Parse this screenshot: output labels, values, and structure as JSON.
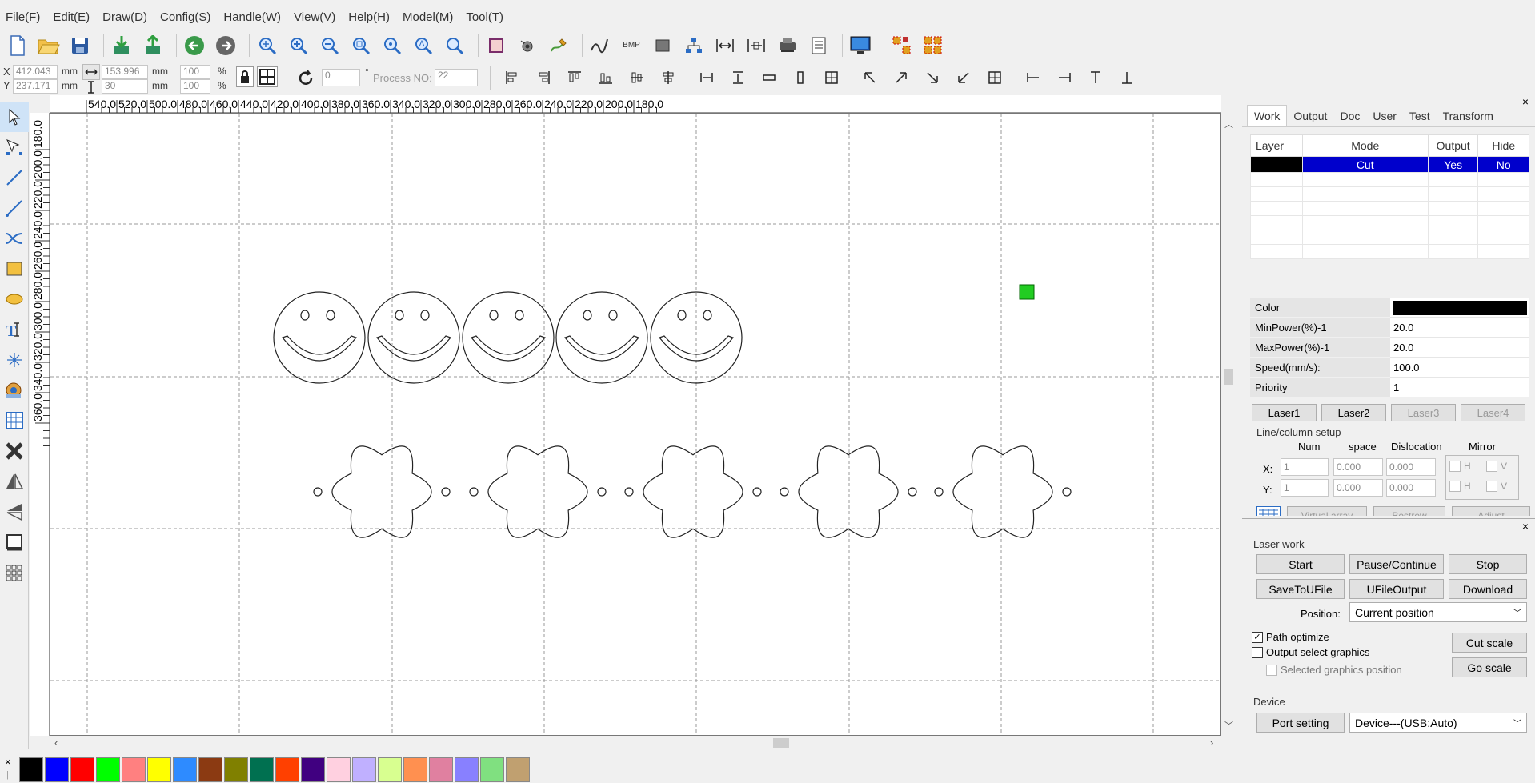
{
  "menu": [
    "File(F)",
    "Edit(E)",
    "Draw(D)",
    "Config(S)",
    "Handle(W)",
    "View(V)",
    "Help(H)",
    "Model(M)",
    "Tool(T)"
  ],
  "toolbar": {
    "file_icons": [
      "new-file-icon",
      "open-folder-icon",
      "save-icon"
    ],
    "import_icons": [
      "import-icon",
      "export-icon",
      "undo-icon",
      "redo-icon"
    ],
    "zoom_icons": [
      "zoom-select-icon",
      "zoom-in-icon",
      "zoom-out-icon",
      "zoom-page-icon",
      "zoom-fit-icon",
      "zoom-real-icon",
      "zoom-window-icon"
    ],
    "bmp_label": "BMP"
  },
  "position_bar": {
    "x_label": "X",
    "y_label": "Y",
    "x_value": "412.043",
    "y_value": "237.171",
    "w_value": "153.996",
    "h_value": "30",
    "unit_mm": "mm",
    "scale_x": "100",
    "scale_y": "100",
    "percent": "%",
    "rotate_value": "0",
    "degree": "°",
    "process_label": "Process NO:",
    "process_value": "22"
  },
  "rulers": {
    "h_ticks": [
      "540.0",
      "520.0",
      "500.0",
      "480.0",
      "460.0",
      "440.0",
      "420.0",
      "400.0",
      "380.0",
      "360.0",
      "340.0",
      "320.0",
      "300.0",
      "280.0",
      "260.0",
      "240.0",
      "220.0",
      "200.0",
      "180.0"
    ],
    "v_ticks": [
      "180.0",
      "200.0",
      "220.0",
      "240.0",
      "260.0",
      "280.0",
      "300.0",
      "320.0",
      "340.0",
      "360.0"
    ]
  },
  "palette": [
    "#000000",
    "#0000ff",
    "#ff0000",
    "#00ff00",
    "#ff8080",
    "#ffff00",
    "#2e8bff",
    "#8b3a12",
    "#808000",
    "#007050",
    "#ff4000",
    "#400080",
    "#ffd0e0",
    "#c0b0ff",
    "#d8ff90",
    "#ff9050",
    "#e080a0",
    "#8880ff",
    "#80e080",
    "#c0a070"
  ],
  "panel": {
    "close": "×",
    "tabs": [
      "Work",
      "Output",
      "Doc",
      "User",
      "Test",
      "Transform"
    ],
    "layer_headers": [
      "Layer",
      "Mode",
      "Output",
      "Hide"
    ],
    "layer_row": {
      "color": "#000000",
      "mode": "Cut",
      "output": "Yes",
      "hide": "No"
    },
    "props": [
      {
        "label": "Color",
        "value": ""
      },
      {
        "label": "MinPower(%)-1",
        "value": "20.0"
      },
      {
        "label": "MaxPower(%)-1",
        "value": "20.0"
      },
      {
        "label": "Speed(mm/s):",
        "value": "100.0"
      },
      {
        "label": "Priority",
        "value": "1"
      }
    ],
    "laser_buttons": [
      "Laser1",
      "Laser2",
      "Laser3",
      "Laser4"
    ],
    "array": {
      "title": "Line/column setup",
      "headers": [
        "Num",
        "space",
        "Dislocation",
        "Mirror"
      ],
      "x_label": "X:",
      "y_label": "Y:",
      "x_num": "1",
      "x_space": "0.000",
      "x_disl": "0.000",
      "y_num": "1",
      "y_space": "0.000",
      "y_disl": "0.000",
      "h": "H",
      "v": "V",
      "buttons": [
        "Virtual array",
        "Bestrew",
        "Adjust"
      ]
    },
    "laser_work": {
      "title": "Laser work",
      "start": "Start",
      "pause": "Pause/Continue",
      "stop": "Stop",
      "save_ufile": "SaveToUFile",
      "ufile_output": "UFileOutput",
      "download": "Download",
      "position_label": "Position:",
      "position_value": "Current position",
      "path_optimize": "Path optimize",
      "output_select": "Output select graphics",
      "selected_pos": "Selected graphics position",
      "cut_scale": "Cut scale",
      "go_scale": "Go scale"
    },
    "device": {
      "title": "Device",
      "port_setting": "Port setting",
      "device_value": "Device---(USB:Auto)"
    }
  }
}
